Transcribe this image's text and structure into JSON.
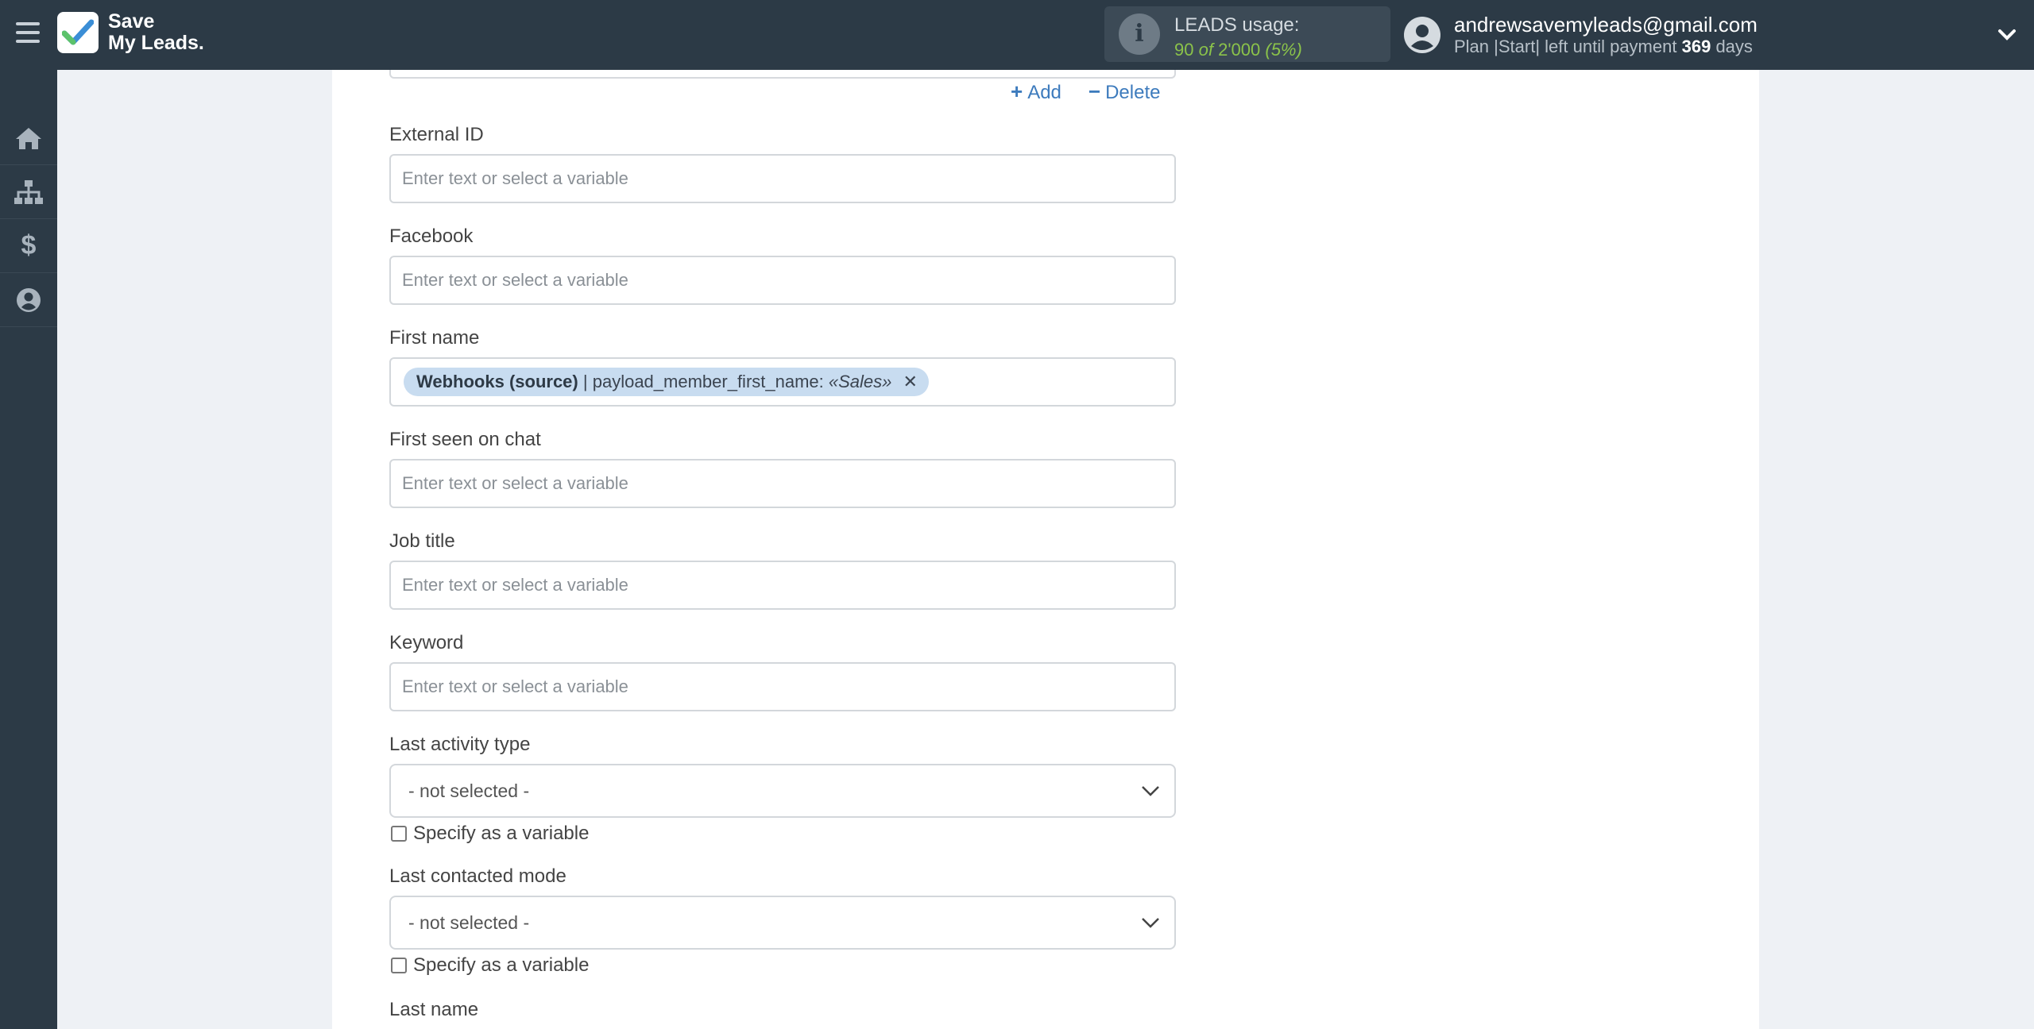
{
  "app": {
    "logo_line1": "Save",
    "logo_line2": "My Leads."
  },
  "usage": {
    "title": "LEADS usage:",
    "used": "90",
    "of_word": "of",
    "limit": "2'000",
    "percent": "(5%)"
  },
  "account": {
    "email": "andrewsavemyleads@gmail.com",
    "plan_prefix": "Plan |Start| left until payment",
    "days": "369",
    "days_suffix": "days"
  },
  "actions": {
    "add": "Add",
    "delete": "Delete"
  },
  "fields": {
    "external_id": {
      "label": "External ID",
      "placeholder": "Enter text or select a variable"
    },
    "facebook": {
      "label": "Facebook",
      "placeholder": "Enter text or select a variable"
    },
    "first_name": {
      "label": "First name",
      "tag_source": "Webhooks (source)",
      "tag_sep": "|",
      "tag_field": "payload_member_first_name:",
      "tag_value": "«Sales»",
      "tag_remove": "✕"
    },
    "first_seen": {
      "label": "First seen on chat",
      "placeholder": "Enter text or select a variable"
    },
    "job_title": {
      "label": "Job title",
      "placeholder": "Enter text or select a variable"
    },
    "keyword": {
      "label": "Keyword",
      "placeholder": "Enter text or select a variable"
    },
    "last_activity_type": {
      "label": "Last activity type",
      "selected": "- not selected -",
      "checkbox": "Specify as a variable"
    },
    "last_contacted_mode": {
      "label": "Last contacted mode",
      "selected": "- not selected -",
      "checkbox": "Specify as a variable"
    },
    "last_name": {
      "label": "Last name"
    }
  },
  "colors": {
    "topbar": "#2c3a46",
    "accent": "#3d7bbd",
    "usage_green": "#8bc34a",
    "tag_bg": "#c8dcf0"
  },
  "icons": [
    "menu-icon",
    "logo-check-icon",
    "info-icon",
    "user-avatar-icon",
    "chevron-down-icon",
    "home-icon",
    "sitemap-icon",
    "dollar-icon",
    "user-circle-icon",
    "plus-icon",
    "minus-icon"
  ]
}
